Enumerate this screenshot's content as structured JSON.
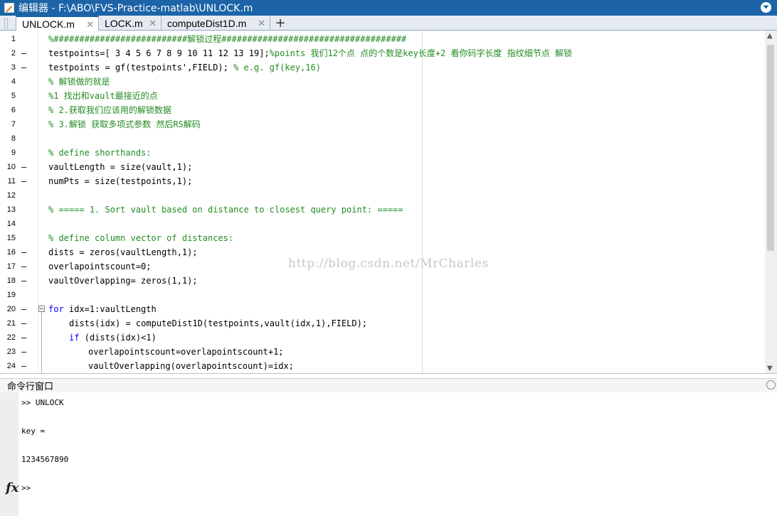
{
  "window": {
    "title": "编辑器 - F:\\ABO\\FVS-Practice-matlab\\UNLOCK.m"
  },
  "tabs": [
    {
      "label": "UNLOCK.m",
      "close": "✕"
    },
    {
      "label": "LOCK.m",
      "close": "✕"
    },
    {
      "label": "computeDist1D.m",
      "close": "✕"
    }
  ],
  "tab_add": "+",
  "editor": {
    "lines": [
      {
        "n": "1",
        "dash": "",
        "indent": 0,
        "segments": [
          {
            "c": "cm",
            "t": "%##########################解锁过程####################################"
          }
        ]
      },
      {
        "n": "2",
        "dash": "—",
        "indent": 0,
        "segments": [
          {
            "c": "tx",
            "t": "testpoints=[ 3 4 5 6 7 8 9 10 11 12 13 19];"
          },
          {
            "c": "cm",
            "t": "%points 我们12个点 点的个数是key长度+2 看你码字长度 指纹细节点 解锁"
          }
        ]
      },
      {
        "n": "3",
        "dash": "—",
        "indent": 0,
        "segments": [
          {
            "c": "tx",
            "t": "testpoints = gf(testpoints',FIELD); "
          },
          {
            "c": "cm",
            "t": "% e.g. gf(key,16)"
          }
        ]
      },
      {
        "n": "4",
        "dash": "",
        "indent": 0,
        "segments": [
          {
            "c": "cm",
            "t": "% 解锁做的就是"
          }
        ]
      },
      {
        "n": "5",
        "dash": "",
        "indent": 0,
        "segments": [
          {
            "c": "cm",
            "t": "%1 找出和vault最接近的点"
          }
        ]
      },
      {
        "n": "6",
        "dash": "",
        "indent": 0,
        "segments": [
          {
            "c": "cm",
            "t": "% 2.获取我们应该用的解锁数据"
          }
        ]
      },
      {
        "n": "7",
        "dash": "",
        "indent": 0,
        "segments": [
          {
            "c": "cm",
            "t": "% 3.解锁 获取多项式参数 然后RS解码"
          }
        ]
      },
      {
        "n": "8",
        "dash": "",
        "indent": 0,
        "segments": []
      },
      {
        "n": "9",
        "dash": "",
        "indent": 0,
        "segments": [
          {
            "c": "cm",
            "t": "% define shorthands:"
          }
        ]
      },
      {
        "n": "10",
        "dash": "—",
        "indent": 0,
        "segments": [
          {
            "c": "tx",
            "t": "vaultLength = size(vault,1);"
          }
        ]
      },
      {
        "n": "11",
        "dash": "—",
        "indent": 0,
        "segments": [
          {
            "c": "tx",
            "t": "numPts = size(testpoints,1);"
          }
        ]
      },
      {
        "n": "12",
        "dash": "",
        "indent": 0,
        "segments": []
      },
      {
        "n": "13",
        "dash": "",
        "indent": 0,
        "segments": [
          {
            "c": "cm",
            "t": "% ===== 1. Sort vault based on distance to closest query point: ====="
          }
        ]
      },
      {
        "n": "14",
        "dash": "",
        "indent": 0,
        "segments": []
      },
      {
        "n": "15",
        "dash": "",
        "indent": 0,
        "segments": [
          {
            "c": "cm",
            "t": "% define column vector of distances:"
          }
        ]
      },
      {
        "n": "16",
        "dash": "—",
        "indent": 0,
        "segments": [
          {
            "c": "tx",
            "t": "dists = zeros(vaultLength,1);"
          }
        ]
      },
      {
        "n": "17",
        "dash": "—",
        "indent": 0,
        "segments": [
          {
            "c": "tx",
            "t": "overlapointscount=0;"
          }
        ]
      },
      {
        "n": "18",
        "dash": "—",
        "indent": 0,
        "segments": [
          {
            "c": "tx",
            "t": "vaultOverlapping= zeros(1,1);"
          }
        ]
      },
      {
        "n": "19",
        "dash": "",
        "indent": 0,
        "segments": []
      },
      {
        "n": "20",
        "dash": "—",
        "indent": 0,
        "fold": true,
        "segments": [
          {
            "c": "kw",
            "t": "for"
          },
          {
            "c": "tx",
            "t": " idx=1:vaultLength"
          }
        ]
      },
      {
        "n": "21",
        "dash": "—",
        "indent": 1,
        "segments": [
          {
            "c": "tx",
            "t": "dists(idx) = computeDist1D(testpoints,vault(idx,1),FIELD);"
          }
        ]
      },
      {
        "n": "22",
        "dash": "—",
        "indent": 1,
        "segments": [
          {
            "c": "kw",
            "t": "if"
          },
          {
            "c": "tx",
            "t": " (dists(idx)<1)"
          }
        ]
      },
      {
        "n": "23",
        "dash": "—",
        "indent": 2,
        "segments": [
          {
            "c": "tx",
            "t": "overlapointscount=overlapointscount+1;"
          }
        ]
      },
      {
        "n": "24",
        "dash": "—",
        "indent": 2,
        "segments": [
          {
            "c": "tx",
            "t": "vaultOverlapping(overlapointscount)=idx;"
          }
        ]
      }
    ],
    "watermark": "http://blog.csdn.net/MrCharles"
  },
  "command_window": {
    "title": "命令行窗口",
    "lines": [
      ">> UNLOCK",
      "",
      "key =",
      "",
      "1234567890",
      "",
      ">>"
    ],
    "fx_label": "fx"
  },
  "scroll": {
    "up": "▲",
    "down": "▼"
  }
}
